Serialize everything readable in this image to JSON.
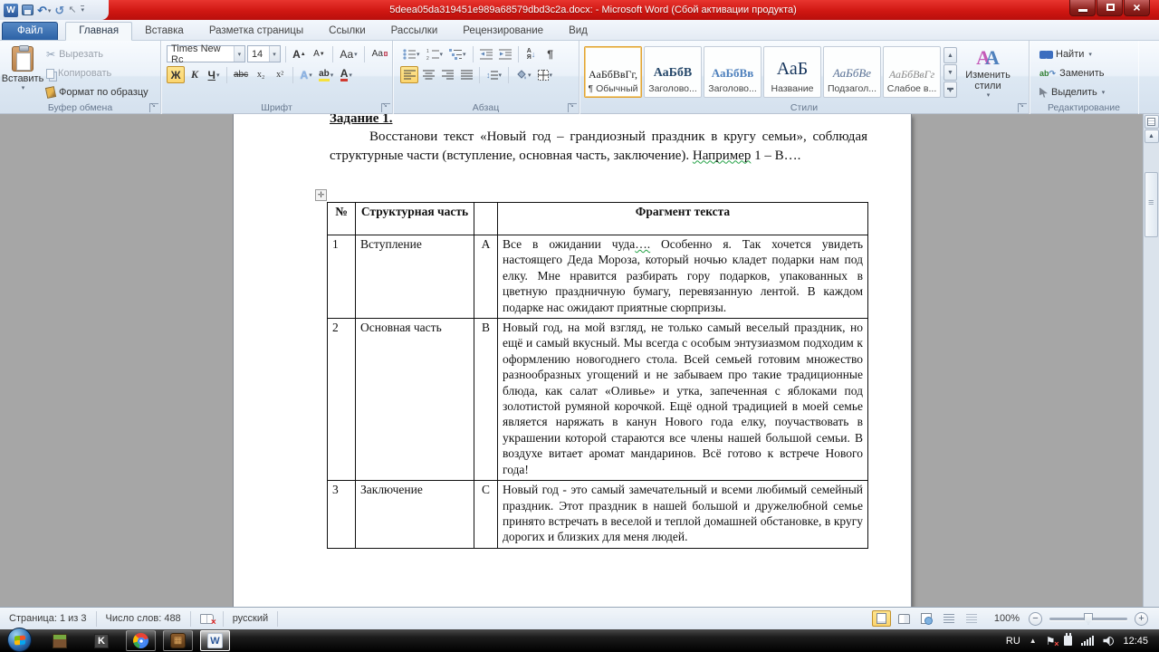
{
  "window": {
    "title": "5deea05da319451e989a68579dbd3c2a.docx: - Microsoft Word (Сбой активации продукта)"
  },
  "colors": {
    "titlebar_red": "#d01712",
    "file_tab_blue": "#2d62a6",
    "selection_highlight": "#fbd56f"
  },
  "tabs": {
    "file": "Файл",
    "items": [
      "Главная",
      "Вставка",
      "Разметка страницы",
      "Ссылки",
      "Рассылки",
      "Рецензирование",
      "Вид"
    ]
  },
  "ribbon": {
    "clipboard": {
      "group": "Буфер обмена",
      "paste": "Вставить",
      "cut": "Вырезать",
      "copy": "Копировать",
      "format_painter": "Формат по образцу"
    },
    "font": {
      "group": "Шрифт",
      "name": "Times New Rc",
      "size": "14",
      "bold": "Ж",
      "italic": "K",
      "underline": "Ч",
      "strikethrough": "abc",
      "subscript": "x₂",
      "superscript": "x²",
      "grow": "А",
      "shrink": "А",
      "change_case": "Аа",
      "effects": "А",
      "highlight": "ab",
      "color": "А"
    },
    "paragraph": {
      "group": "Абзац",
      "sort_a": "А",
      "sort_z": "Я"
    },
    "styles": {
      "group": "Стили",
      "change_label": "Изменить стили",
      "items": [
        {
          "preview": "АаБбВвГг,",
          "name": "¶ Обычный"
        },
        {
          "preview": "АаБбВ",
          "name": "Заголово..."
        },
        {
          "preview": "АаБбВв",
          "name": "Заголово..."
        },
        {
          "preview": "АаБ",
          "name": "Название"
        },
        {
          "preview": "АаБбВе",
          "name": "Подзагол..."
        },
        {
          "preview": "АаБбВвГг",
          "name": "Слабое в..."
        }
      ]
    },
    "editing": {
      "group": "Редактирование",
      "find": "Найти",
      "replace": "Заменить",
      "select": "Выделить"
    }
  },
  "document": {
    "heading": "Задание 1.",
    "intro_before": "Восстанови текст  «Новый год – грандиозный праздник в кругу семьи», соблюдая структурные части (вступление, основная часть, заключение). ",
    "intro_marked": "Например",
    "intro_after": " 1 – В….",
    "table": {
      "headers": [
        "№",
        "Структурная часть",
        "",
        "Фрагмент текста"
      ],
      "rows": [
        {
          "num": "1",
          "part": "Вступление",
          "letter": "А",
          "text_a": "Все в ожидании чуда",
          "dots": "….",
          "text_b": " Особенно я. Так хочется увидеть настоящего Деда Мороза, который ночью кладет подарки нам под елку. Мне нравится разбирать гору подарков, упакованных в цветную праздничную бумагу, перевязанную лентой. В каждом подарке нас ожидают приятные сюрпризы."
        },
        {
          "num": "2",
          "part": "Основная часть",
          "letter": "В",
          "text": "Новый год, на мой взгляд, не только самый веселый праздник, но ещё и самый вкусный. Мы всегда с особым энтузиазмом подходим к оформлению новогоднего стола. Всей семьей готовим множество разнообразных угощений и не забываем про такие традиционные блюда, как салат «Оливье» и утка, запеченная с яблоками под золотистой румяной корочкой. Ещё одной традицией в моей семье является наряжать в канун Нового года елку, поучаствовать в украшении которой стараются все члены нашей большой семьи. В воздухе витает аромат мандаринов. Всё готово к встрече Нового года!"
        },
        {
          "num": "3",
          "part": "Заключение",
          "letter": "С",
          "text": "Новый год - это самый замечательный и всеми любимый семейный праздник. Этот праздник в нашей большой и дружелюбной семье принято встречать в веселой и теплой домашней обстановке, в кругу дорогих и близких для меня людей."
        }
      ]
    }
  },
  "status_bar": {
    "page": "Страница: 1 из 3",
    "words": "Число слов: 488",
    "language": "русский",
    "zoom_value": "100%"
  },
  "taskbar": {
    "language": "RU",
    "time": "12:45"
  }
}
